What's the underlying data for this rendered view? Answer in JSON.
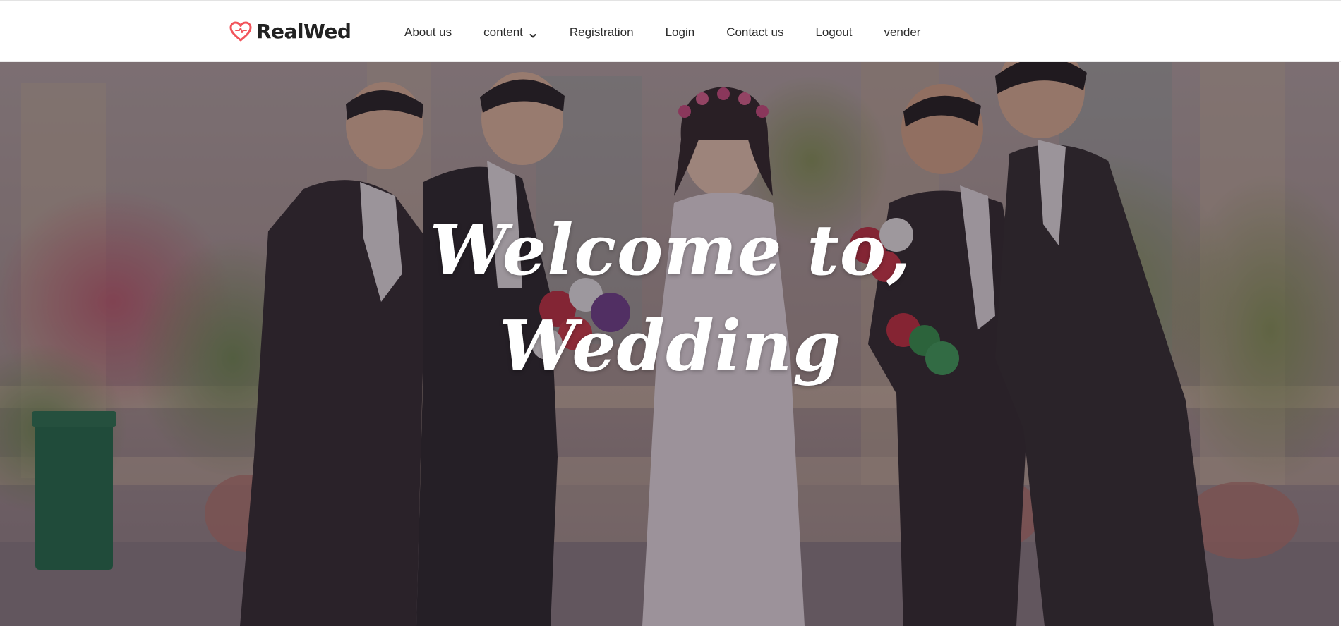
{
  "brand": {
    "name": "RealWed",
    "icon": "heart-outline-icon",
    "icon_color": "#f2545b"
  },
  "nav": {
    "items": [
      {
        "label": "About us"
      },
      {
        "label": "content",
        "icon": "chevron-down-icon"
      },
      {
        "label": "Registration"
      },
      {
        "label": "Login"
      },
      {
        "label": "Contact us"
      },
      {
        "label": "Logout"
      },
      {
        "label": "vender"
      }
    ]
  },
  "hero": {
    "title_line1": "Welcome to,",
    "title_line2": "Wedding",
    "background": "wedding-group-photo",
    "overlay_color": "#281e2a"
  }
}
